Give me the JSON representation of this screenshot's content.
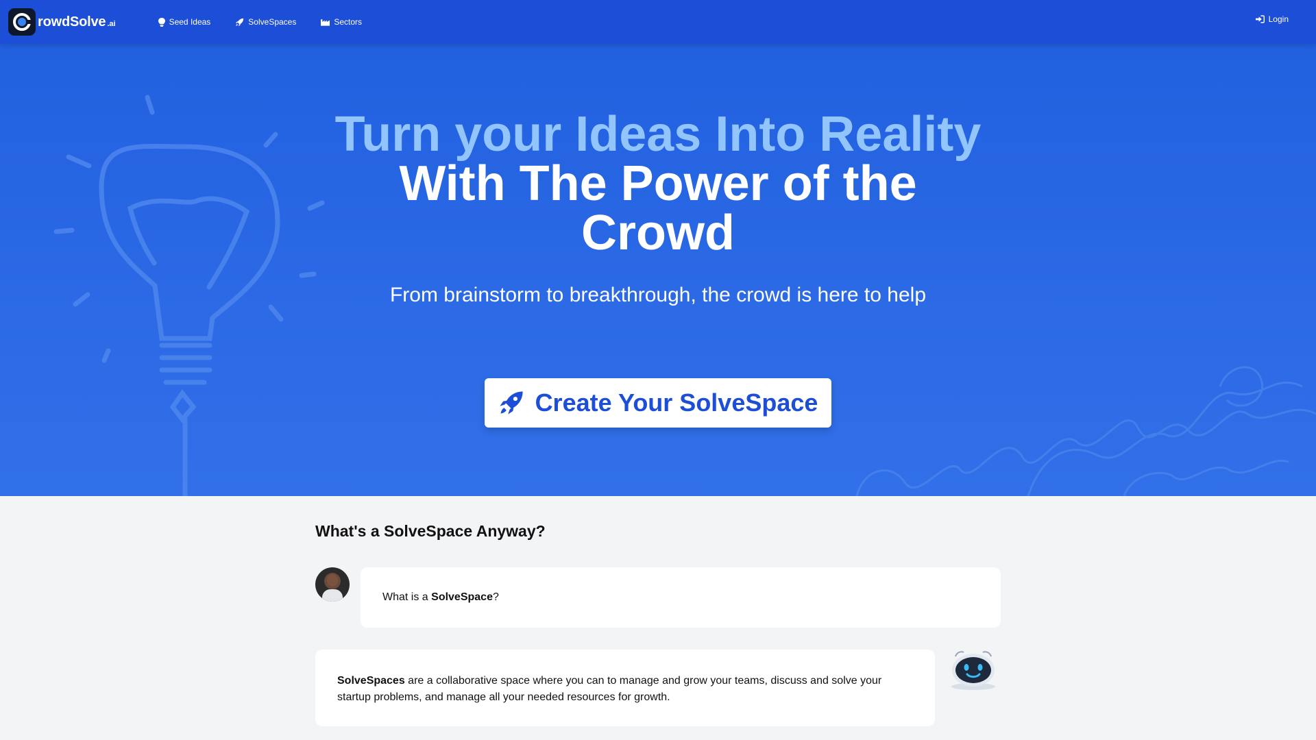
{
  "brand": {
    "name": "rowdSolve",
    "suffix": ".ai",
    "logo_icon": "crowdsolve-logo-icon"
  },
  "nav": {
    "items": [
      {
        "label": "Seed Ideas",
        "icon": "lightbulb-icon"
      },
      {
        "label": "SolveSpaces",
        "icon": "rocket-icon"
      },
      {
        "label": "Sectors",
        "icon": "industry-icon"
      }
    ],
    "login_label": "Login",
    "login_icon": "sign-in-icon"
  },
  "hero": {
    "title_line1": "Turn your Ideas Into Reality",
    "title_line2": "With The Power of the",
    "title_line3": "Crowd",
    "subtitle": "From brainstorm to breakthrough, the crowd is here to help",
    "cta_label": "Create Your SolveSpace",
    "cta_icon": "rocket-icon"
  },
  "faq": {
    "title": "What's a SolveSpace Anyway?",
    "question_prefix": "What is a ",
    "question_bold": "SolveSpace",
    "question_suffix": "?",
    "answer_bold": "SolveSpaces",
    "answer_rest": " are a collaborative space where you can to manage and grow your teams, discuss and solve your startup problems, and manage all your needed resources for growth."
  },
  "colors": {
    "navbar": "#1d4ed8",
    "hero_bg": "#2c6ae6",
    "title_accent": "#93c5fd",
    "cta_text": "#1d4ed8",
    "page_bg": "#f3f4f6"
  }
}
